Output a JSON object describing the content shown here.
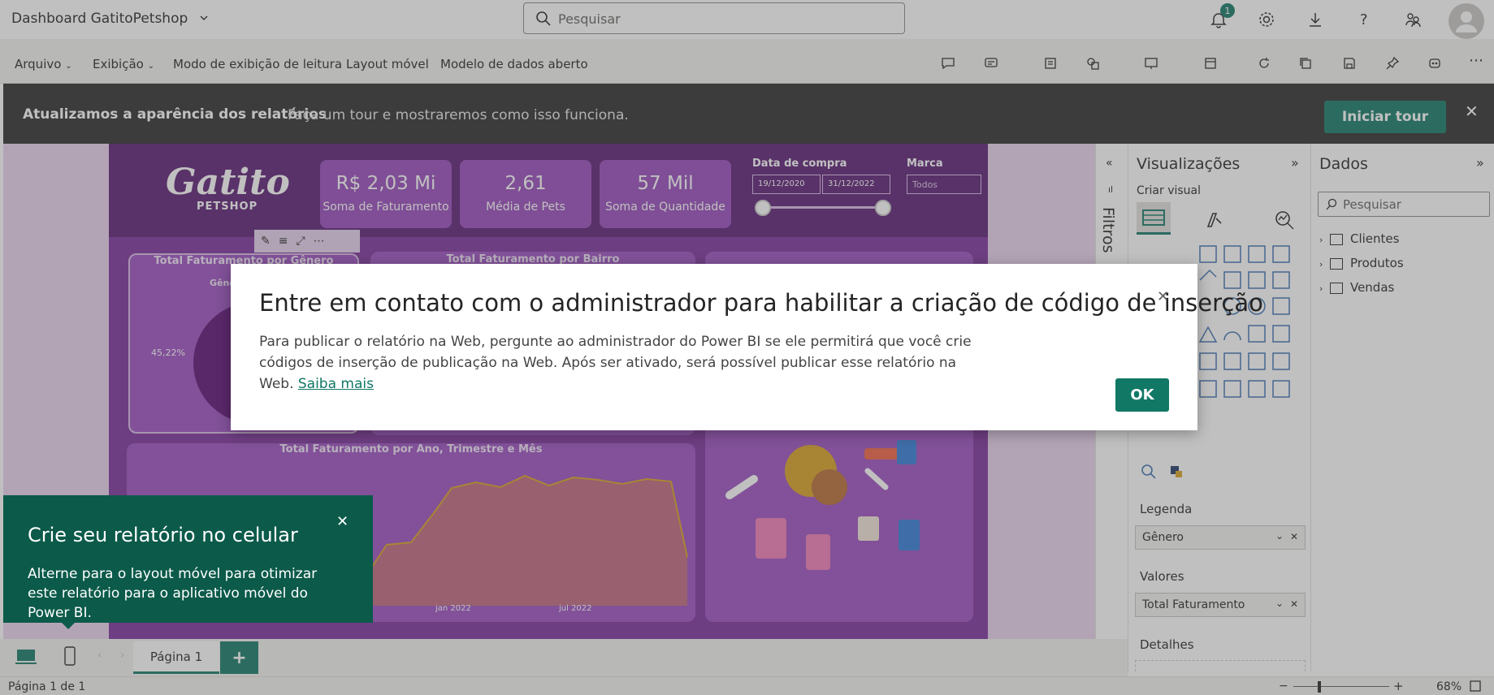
{
  "app": {
    "title": "Dashboard GatitoPetshop",
    "search_placeholder": "Pesquisar",
    "notification_count": "1"
  },
  "ribbon": {
    "items": [
      "Arquivo",
      "Exibição",
      "Modo de exibição de leitura",
      "Layout móvel",
      "Modelo de dados aberto"
    ]
  },
  "banner": {
    "title": "Atualizamos a aparência dos relatórios",
    "text": "Faça um tour e mostraremos como isso funciona.",
    "button": "Iniciar tour"
  },
  "report": {
    "logo_main": "Gatito",
    "logo_sub": "PETSHOP",
    "kpis": [
      {
        "value": "R$ 2,03 Mi",
        "label": "Soma de Faturamento"
      },
      {
        "value": "2,61",
        "label": "Média de Pets"
      },
      {
        "value": "57 Mil",
        "label": "Soma de Quantidade"
      }
    ],
    "date_filter": {
      "label": "Data de compra",
      "from": "19/12/2020",
      "to": "31/12/2022"
    },
    "brand_filter": {
      "label": "Marca",
      "value": "Todos"
    },
    "visual_titles": {
      "genero": "Total Faturamento por Gênero",
      "genero_legend": "Gênero",
      "bairro": "Total Faturamento por Bairro",
      "ano": "Total Faturamento por Ano, Trimestre e Mês"
    },
    "pie_label": "45,22%",
    "line_ticks": [
      "jan 2022",
      "jul 2022"
    ]
  },
  "filters": {
    "label": "Filtros"
  },
  "viz_pane": {
    "title": "Visualizações",
    "subtitle": "Criar visual",
    "wells": [
      {
        "label": "Legenda",
        "field": "Gênero"
      },
      {
        "label": "Valores",
        "field": "Total Faturamento"
      },
      {
        "label": "Detalhes",
        "field": ""
      }
    ]
  },
  "data_pane": {
    "title": "Dados",
    "search_placeholder": "Pesquisar",
    "tables": [
      "Clientes",
      "Produtos",
      "Vendas"
    ]
  },
  "dialog": {
    "title": "Entre em contato com o administrador para habilitar a criação de código de inserção",
    "body": "Para publicar o relatório na Web, pergunte ao administrador do Power BI se ele permitirá que você crie códigos de inserção de publicação na Web. Após ser ativado, será possível publicar esse relatório na Web.",
    "link": "Saiba mais",
    "ok": "OK"
  },
  "tip": {
    "title": "Crie seu relatório no celular",
    "text": "Alterne para o layout móvel para otimizar este relatório para o aplicativo móvel do Power BI."
  },
  "tabs": {
    "page": "Página 1",
    "add": "+"
  },
  "status": {
    "page_count": "Página 1 de 1",
    "zoom": "68%"
  },
  "colors": {
    "accent": "#117865",
    "report_bg": "#7b2e9b",
    "kpi_bg": "#9647bb"
  }
}
